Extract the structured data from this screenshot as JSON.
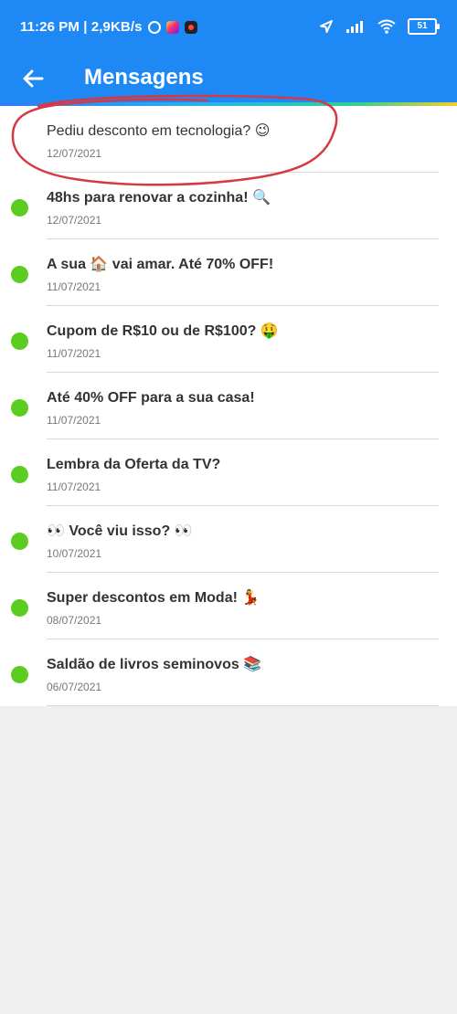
{
  "colors": {
    "primary": "#1e88f5",
    "unread": "#5bcc20",
    "annotation": "#d43a45"
  },
  "status_bar": {
    "time_speed": "11:26 PM | 2,9KB/s",
    "battery": "51",
    "icons": [
      "alarm-icon",
      "instagram-icon",
      "app-notification-icon",
      "location-icon",
      "signal-icon",
      "wifi-icon",
      "battery-icon"
    ]
  },
  "header": {
    "title": "Mensagens",
    "back_icon": "back-arrow-icon"
  },
  "messages": [
    {
      "title": "Pediu desconto em tecnologia? 😉",
      "date": "12/07/2021",
      "unread": false
    },
    {
      "title": "48hs para renovar a cozinha! 🔍",
      "date": "12/07/2021",
      "unread": true
    },
    {
      "title": "A sua 🏠 vai amar. Até 70% OFF!",
      "date": "11/07/2021",
      "unread": true
    },
    {
      "title": "Cupom de R$10 ou de R$100? 🤑",
      "date": "11/07/2021",
      "unread": true
    },
    {
      "title": "Até 40% OFF para a sua casa!",
      "date": "11/07/2021",
      "unread": true
    },
    {
      "title": "Lembra da Oferta da TV?",
      "date": "11/07/2021",
      "unread": true
    },
    {
      "title": "👀 Você viu isso? 👀",
      "date": "10/07/2021",
      "unread": true
    },
    {
      "title": "Super descontos em Moda! 💃",
      "date": "08/07/2021",
      "unread": true
    },
    {
      "title": "Saldão de livros seminovos 📚",
      "date": "06/07/2021",
      "unread": true
    }
  ]
}
